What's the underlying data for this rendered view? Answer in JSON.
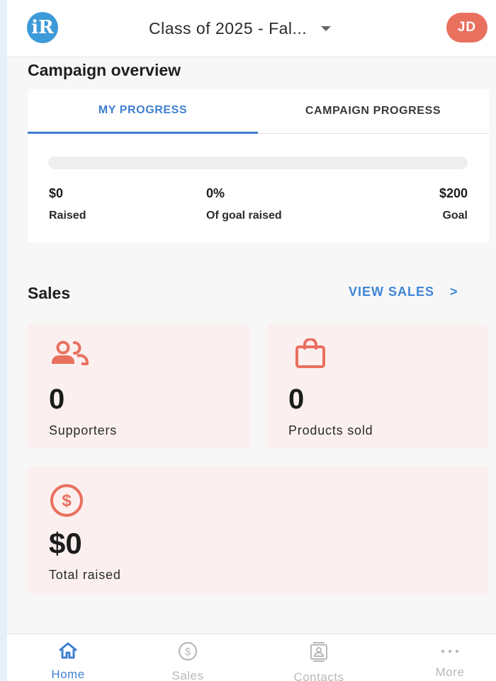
{
  "header": {
    "logo_text": "iR",
    "campaign_name": "Class of 2025 - Fal...",
    "avatar_initials": "JD"
  },
  "overview": {
    "title": "Campaign overview",
    "tabs": [
      {
        "label": "MY PROGRESS",
        "active": true
      },
      {
        "label": "CAMPAIGN PROGRESS",
        "active": false
      }
    ],
    "progress_fraction": 0,
    "stats": [
      {
        "value": "$0",
        "label": "Raised"
      },
      {
        "value": "0%",
        "label": "Of goal raised"
      },
      {
        "value": "$200",
        "label": "Goal"
      }
    ]
  },
  "sales": {
    "title": "Sales",
    "view_label": "VIEW SALES",
    "view_chevron": ">",
    "tiles": [
      {
        "icon": "supporters-icon",
        "value": "0",
        "label": "Supporters"
      },
      {
        "icon": "shopping-bag-icon",
        "value": "0",
        "label": "Products sold"
      },
      {
        "icon": "dollar-circle-icon",
        "value": "$0",
        "label": "Total raised"
      }
    ]
  },
  "nav": {
    "items": [
      {
        "label": "Home",
        "icon": "home-icon",
        "active": true
      },
      {
        "label": "Sales",
        "icon": "dollar-circle-icon",
        "active": false
      },
      {
        "label": "Contacts",
        "icon": "contacts-icon",
        "active": false
      },
      {
        "label": "More",
        "icon": "more-icon",
        "active": false
      }
    ]
  },
  "colors": {
    "accent": "#3f7fd0",
    "brand_logo": "#3d9ad8",
    "avatar": "#e9705f",
    "tile_background": "#fbf0ef",
    "tile_icon": "#e9705f",
    "nav_inactive": "#b8b8b8"
  }
}
